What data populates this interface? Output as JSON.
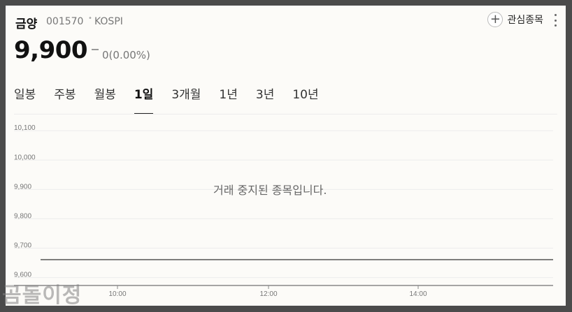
{
  "stock": {
    "name": "금양",
    "code": "001570",
    "separator": "•",
    "market": "KOSPI",
    "price": "9,900",
    "change": "0(0.00%)"
  },
  "actions": {
    "favorite_label": "관심종목",
    "favorite_icon": "plus-icon",
    "more_icon": "more-vertical-icon"
  },
  "tabs": [
    {
      "label": "일봉",
      "active": false
    },
    {
      "label": "주봉",
      "active": false
    },
    {
      "label": "월봉",
      "active": false
    },
    {
      "label": "1일",
      "active": true
    },
    {
      "label": "3개월",
      "active": false
    },
    {
      "label": "1년",
      "active": false
    },
    {
      "label": "3년",
      "active": false
    },
    {
      "label": "10년",
      "active": false
    }
  ],
  "message": "거래 중지된 종목입니다.",
  "watermark": "곰돌이정",
  "chart_data": {
    "type": "line",
    "title": "",
    "xlabel": "",
    "ylabel": "",
    "y_ticks": [
      "10,100",
      "10,000",
      "9,900",
      "9,800",
      "9,700",
      "9,600"
    ],
    "y_tick_values": [
      10100,
      10000,
      9900,
      9800,
      9700,
      9600
    ],
    "x_ticks": [
      "10:00",
      "12:00",
      "14:00"
    ],
    "ylim": [
      9580,
      10110
    ],
    "series": [
      {
        "values": [
          9580,
          9580
        ]
      }
    ],
    "grid": true,
    "colors": {
      "line": "#333333",
      "grid": "#ececec",
      "axis": "#888888",
      "tick_label": "#777777"
    }
  }
}
